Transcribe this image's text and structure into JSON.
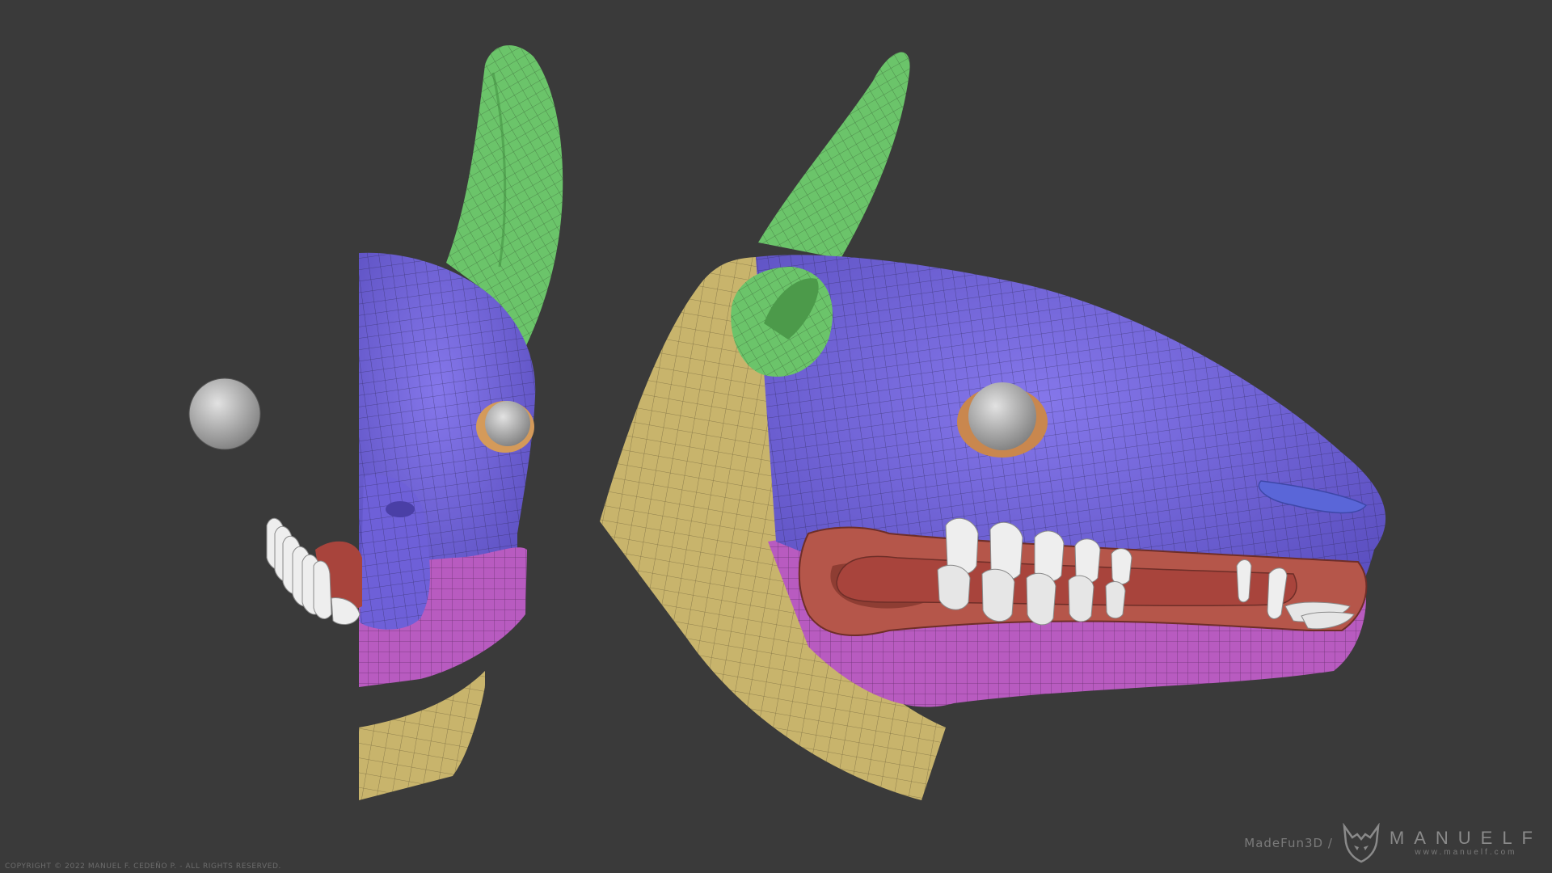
{
  "scene": {
    "background": "#3a3a3a",
    "colors": {
      "head_purple": "#6f62d6",
      "ear_green": "#6bc46a",
      "neck_yellow": "#c8b46c",
      "jaw_pink": "#b85bc0",
      "mouth_red": "#b5564a",
      "tongue": "#a8443c",
      "teeth": "#eeeeee",
      "eye_gray": "#a8a8a8",
      "nostril_blue": "#5a66d8"
    },
    "views": [
      "front-view",
      "side-view"
    ]
  },
  "footer": {
    "copyright": "COPYRIGHT © 2022 MANUEL F. CEDEÑO P. - ALL RIGHTS RESERVED.",
    "madefun": "MadeFun3D /",
    "brand_name": "MANUELF",
    "brand_url": "www.manuelf.com",
    "logo_icon": "horned-mask-icon"
  }
}
